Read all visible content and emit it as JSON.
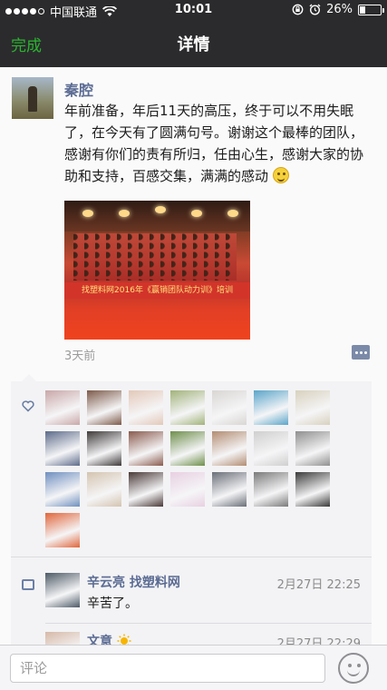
{
  "status_bar": {
    "carrier": "中国联通",
    "time": "10:01",
    "battery": "26%",
    "battery_level": 0.26
  },
  "nav": {
    "back_label": "完成",
    "title": "详情"
  },
  "post": {
    "author": "秦腔",
    "text": "年前准备，年后11天的高压，终于可以不用失眠了，在今天有了圆满句号。谢谢这个最棒的团队，感谢有你们的责有所归，任由心生，感谢大家的协助和支持，百感交集，满满的感动",
    "photo_banner": "找塑料网2016年《赢销团队动力训》培训",
    "time_ago": "3天前"
  },
  "likes": {
    "icon": "heart-icon",
    "avatar_colors": [
      "#c9a7a8",
      "#7d5a4a",
      "#e3c8b9",
      "#a2b37a",
      "#d9d6d3",
      "#5aa5c9",
      "#d8d1be",
      "#5d6b8a",
      "#3f3a3a",
      "#8a5b4e",
      "#6f8f4c",
      "#b38d72",
      "#cfcfcf",
      "#8f8f8f",
      "#6f8fbf",
      "#d4c4b0",
      "#4a3a38",
      "#e8d0e2",
      "#6a6f78",
      "#7a7a7a",
      "#3a3a3a",
      "#e0663c"
    ]
  },
  "comments": [
    {
      "name": "辛云亮 找塑料网",
      "time": "2月27日 22:25",
      "text": "辛苦了。",
      "avatar_color": "#4d5a66"
    },
    {
      "name": "文意",
      "time": "2月27日 22:29",
      "text": "",
      "avatar_color": "#d6b9a8"
    }
  ],
  "input": {
    "placeholder": "评论"
  }
}
